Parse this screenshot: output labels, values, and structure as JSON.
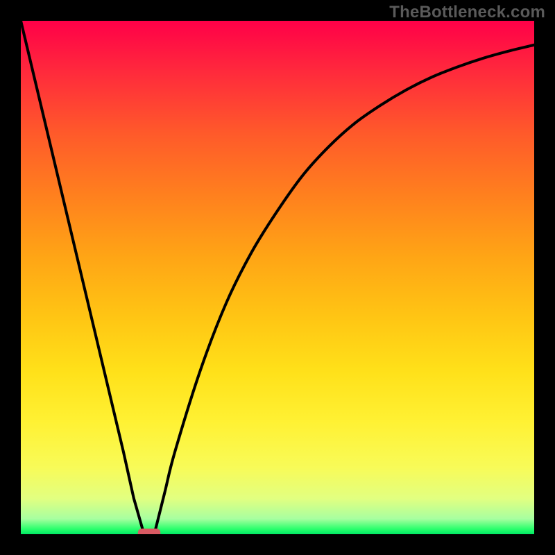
{
  "watermark": "TheBottleneck.com",
  "chart_data": {
    "type": "line",
    "title": "",
    "xlabel": "",
    "ylabel": "",
    "xlim": [
      0,
      100
    ],
    "ylim": [
      0,
      100
    ],
    "grid": false,
    "legend": false,
    "series": [
      {
        "name": "left-branch",
        "x": [
          0,
          5,
          10,
          15,
          20,
          22,
          24
        ],
        "y": [
          100,
          79,
          58,
          37,
          16,
          7,
          0
        ]
      },
      {
        "name": "right-branch",
        "x": [
          26,
          28,
          30,
          35,
          40,
          45,
          50,
          55,
          60,
          65,
          70,
          75,
          80,
          85,
          90,
          95,
          100
        ],
        "y": [
          0,
          8,
          16,
          32,
          45,
          55,
          63,
          70,
          75.5,
          80,
          83.5,
          86.5,
          89,
          91,
          92.7,
          94.1,
          95.3
        ]
      }
    ],
    "annotations": [
      {
        "type": "marker",
        "shape": "pill",
        "x": 25,
        "y": 0,
        "color": "#d95a63"
      }
    ]
  },
  "colors": {
    "frame": "#000000",
    "watermark": "#5a5a5a",
    "curve": "#000000",
    "marker": "#d95a63"
  }
}
